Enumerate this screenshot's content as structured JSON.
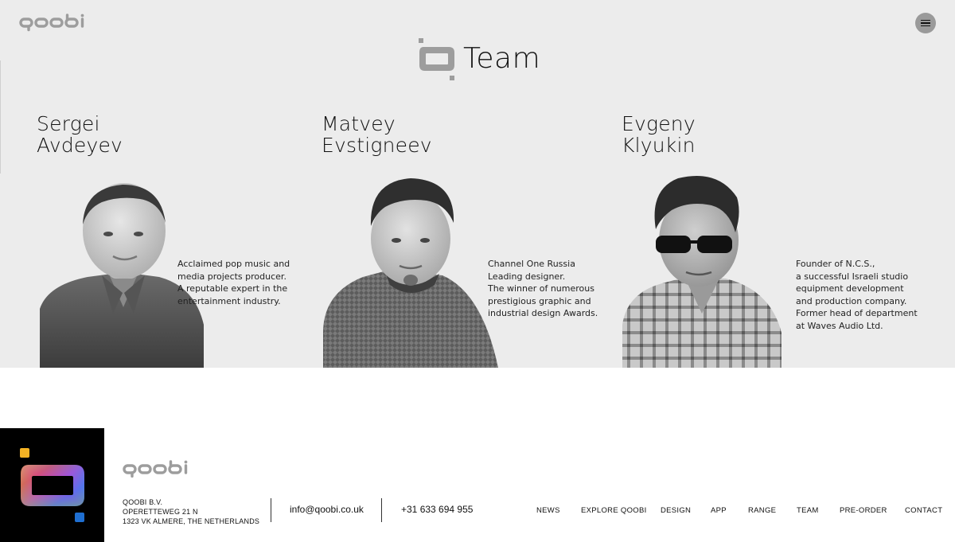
{
  "brand": {
    "name": "qoobi"
  },
  "header": {
    "menu_icon": "hamburger-icon",
    "title": "Team"
  },
  "team": [
    {
      "first_name": "Sergei",
      "last_name": "Avdeyev",
      "bio": [
        "Acclaimed pop music and",
        "media projects producer.",
        "A reputable expert in the",
        "entertainment industry."
      ]
    },
    {
      "first_name": "Matvey",
      "last_name": "Evstigneev",
      "bio": [
        "Channel One Russia",
        "Leading designer.",
        "The winner of numerous",
        "prestigious graphic and",
        "industrial design Awards."
      ]
    },
    {
      "first_name": "Evgeny",
      "last_name": "Klyukin",
      "bio": [
        "Founder of N.C.S.,",
        "a successful Israeli studio",
        "equipment development",
        "and production company.",
        "Former head of department",
        "at Waves Audio Ltd."
      ]
    }
  ],
  "footer": {
    "address": [
      "QOOBI B.V.",
      "OPERETTEWEG 21 N",
      "1323 VK ALMERE, THE NETHERLANDS"
    ],
    "email": "info@qoobi.co.uk",
    "phone": "+31 633 694 955",
    "nav": [
      "NEWS",
      "EXPLORE QOOBI",
      "DESIGN",
      "APP",
      "RANGE",
      "TEAM",
      "PRE-ORDER",
      "CONTACT"
    ]
  },
  "colors": {
    "hero_background": "#ececec",
    "logo_gray": "#9d9d9d",
    "footer_black": "#000000",
    "accent_yellow": "#f5b324",
    "accent_blue": "#1f6fd1"
  }
}
